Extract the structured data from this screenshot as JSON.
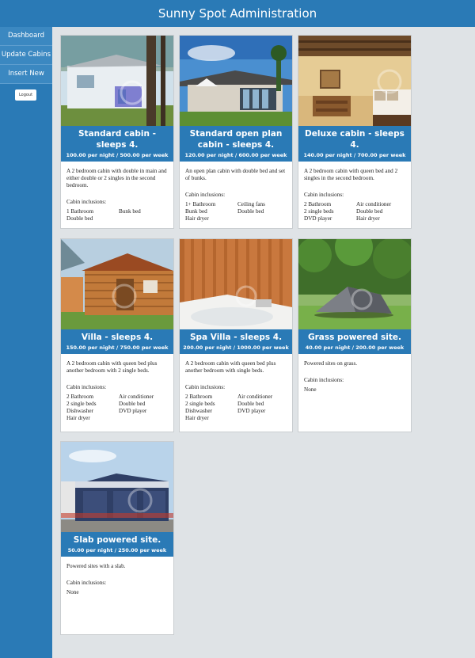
{
  "header": {
    "title": "Sunny Spot Administration"
  },
  "sidebar": {
    "items": [
      {
        "label": "Dashboard"
      },
      {
        "label": "Update Cabins"
      },
      {
        "label": "Insert New"
      }
    ],
    "logout_label": "Logout"
  },
  "inclusions_label": "Cabin inclusions:",
  "cabins": [
    {
      "name": "Standard cabin - sleeps 4.",
      "price": "100.00 per night / 500.00 per week",
      "description": "A 2 bedroom cabin with double in main and either double or 2 singles in the second bedroom.",
      "inclusions": [
        "1 Bathroom",
        "Bunk bed",
        "Double bed"
      ]
    },
    {
      "name": "Standard open plan cabin - sleeps 4.",
      "price": "120.00 per night / 600.00 per week",
      "description": "An open plan cabin with double bed and set of bunks.",
      "inclusions": [
        "1+ Bathroom",
        "Ceiling fans",
        "Bunk bed",
        "Double bed",
        "Hair dryer"
      ]
    },
    {
      "name": "Deluxe cabin - sleeps 4.",
      "price": "140.00 per night / 700.00 per week",
      "description": "A 2 bedroom cabin with queen bed and 2 singles in the second bedroom.",
      "inclusions": [
        "2 Bathroom",
        "Air conditioner",
        "2 single beds",
        "Double bed",
        "DVD player",
        "Hair dryer"
      ]
    },
    {
      "name": "Villa - sleeps 4.",
      "price": "150.00 per night / 750.00 per week",
      "description": "A 2 bedroom cabin with queen bed plus another bedroom with 2 single beds.",
      "inclusions": [
        "2 Bathroom",
        "Air conditioner",
        "2 single beds",
        "Double bed",
        "Dishwasher",
        "DVD player",
        "Hair dryer"
      ]
    },
    {
      "name": "Spa Villa - sleeps 4.",
      "price": "200.00 per night / 1000.00 per week",
      "description": "A 2 bedroom cabin with queen bed plus another bedroom with single beds.",
      "inclusions": [
        "2 Bathroom",
        "Air conditioner",
        "2 single beds",
        "Double bed",
        "Dishwasher",
        "DVD player",
        "Hair dryer"
      ]
    },
    {
      "name": "Grass powered site.",
      "price": "40.00 per night / 200.00 per week",
      "description": "Powered sites on grass.",
      "inclusions": [
        "None"
      ]
    },
    {
      "name": "Slab powered site.",
      "price": "50.00 per night / 250.00 per week",
      "description": "Powered sites with a slab.",
      "inclusions": [
        "None"
      ]
    }
  ]
}
